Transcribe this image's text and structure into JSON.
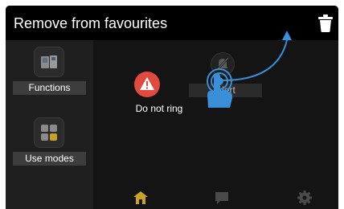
{
  "header": {
    "title": "Remove from favourites",
    "trash_icon": "trash-icon"
  },
  "sidebar": {
    "items": [
      {
        "label": "Functions",
        "icon": "functions-icon"
      },
      {
        "label": "Use modes",
        "icon": "use-modes-icon"
      }
    ]
  },
  "favourites": [
    {
      "label": "Do not ring",
      "icon": "warning-icon",
      "color": "#e04a3f"
    },
    {
      "label": "Alert",
      "icon": "bell-off-icon"
    }
  ],
  "gesture": {
    "hand_icon": "tap-hand-icon",
    "arrow_icon": "drag-arrow-icon",
    "color": "#3a8fd9"
  },
  "tabbar": {
    "items": [
      {
        "icon": "home-icon",
        "active": true,
        "color": "#c9a227"
      },
      {
        "icon": "chat-icon",
        "active": false
      },
      {
        "icon": "settings-icon",
        "active": false
      }
    ]
  }
}
